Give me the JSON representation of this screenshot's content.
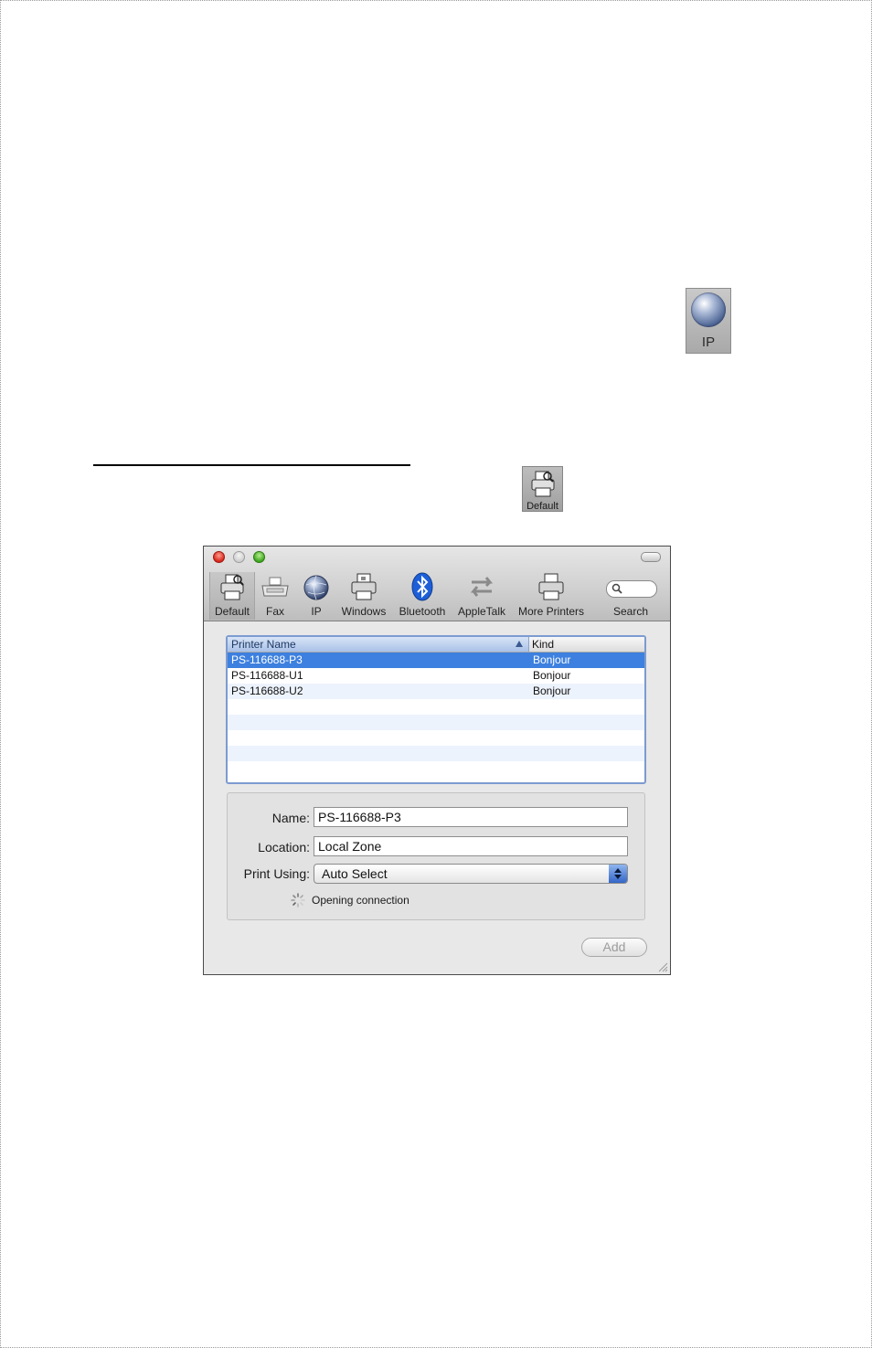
{
  "doc": {
    "ip_icon_label": "IP",
    "default_icon_label": "Default"
  },
  "window": {
    "toolbar": [
      {
        "label": "Default",
        "icon": "printer-magnifier-icon"
      },
      {
        "label": "Fax",
        "icon": "fax-icon"
      },
      {
        "label": "IP",
        "icon": "globe-icon"
      },
      {
        "label": "Windows",
        "icon": "printer-icon"
      },
      {
        "label": "Bluetooth",
        "icon": "bluetooth-icon"
      },
      {
        "label": "AppleTalk",
        "icon": "arrows-icon"
      },
      {
        "label": "More Printers",
        "icon": "printer-icon"
      },
      {
        "label": "Search",
        "icon": "search-icon"
      }
    ],
    "list": {
      "columns": [
        "Printer Name",
        "Kind"
      ],
      "rows": [
        {
          "name": "PS-116688-P3",
          "kind": "Bonjour"
        },
        {
          "name": "PS-116688-U1",
          "kind": "Bonjour"
        },
        {
          "name": "PS-116688-U2",
          "kind": "Bonjour"
        }
      ]
    },
    "form": {
      "name_label": "Name:",
      "name_value": "PS-116688-P3",
      "location_label": "Location:",
      "location_value": "Local Zone",
      "print_using_label": "Print Using:",
      "print_using_value": "Auto Select",
      "status": "Opening connection"
    },
    "add_label": "Add"
  }
}
